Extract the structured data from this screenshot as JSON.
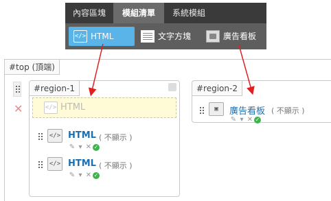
{
  "tabs": [
    {
      "label": "內容區塊"
    },
    {
      "label": "模組清單"
    },
    {
      "label": "系統模組"
    }
  ],
  "tools": [
    {
      "label": "HTML",
      "icon": "code-icon"
    },
    {
      "label": "文字方塊",
      "icon": "text-block-icon"
    },
    {
      "label": "廣告看板",
      "icon": "billboard-icon"
    }
  ],
  "top_region": {
    "label": "#top (頂端)"
  },
  "region1": {
    "label": "#region-1",
    "placeholder": "HTML",
    "modules": [
      {
        "title": "HTML",
        "note": "( 不顯示 )"
      },
      {
        "title": "HTML",
        "note": "( 不顯示 )"
      }
    ]
  },
  "region2": {
    "label": "#region-2",
    "modules": [
      {
        "title": "廣告看板",
        "note": "( 不顯示 )"
      }
    ]
  },
  "icon_glyphs": {
    "code": "</>"
  },
  "colors": {
    "accent": "#5ab4e8",
    "arrow": "#e02020",
    "link": "#1d6fb0",
    "ok": "#3bb54a"
  }
}
